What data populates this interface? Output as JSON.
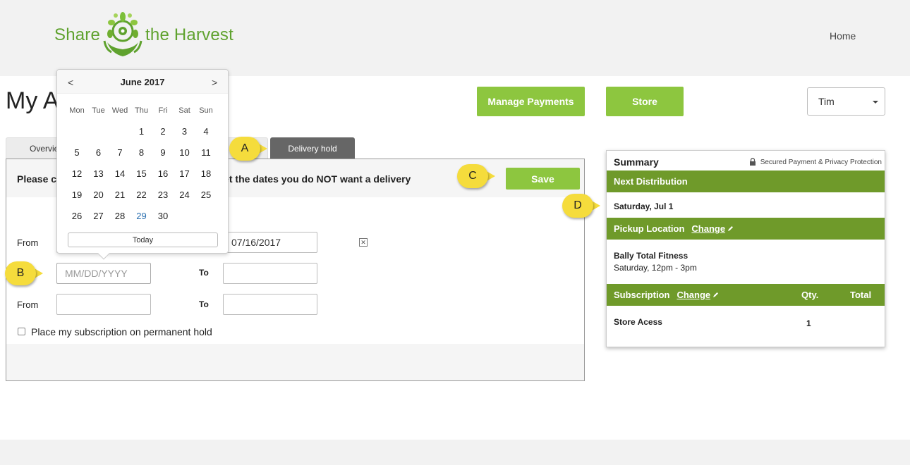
{
  "brand": {
    "left": "Share",
    "right": "the Harvest",
    "color": "#5fa22e"
  },
  "nav": {
    "home": "Home"
  },
  "page": {
    "title": "My Ac"
  },
  "buttons": {
    "manage_payments": "Manage Payments",
    "store": "Store",
    "save": "Save",
    "accent": "#8dc63f"
  },
  "user": {
    "selected": "Tim"
  },
  "tabs": {
    "overview": "Overvie",
    "delivery_hold": "Delivery hold"
  },
  "panel": {
    "instruction_start": "Please c",
    "instruction_end": "et the dates you do NOT want a delivery",
    "rows": [
      {
        "from_label": "From",
        "from_value": "",
        "to_label": "",
        "to_value": "07/16/2017"
      },
      {
        "from_label": "",
        "from_placeholder": "MM/DD/YYYY",
        "to_label": "To",
        "to_value": ""
      },
      {
        "from_label": "From",
        "from_value": "",
        "to_label": "To",
        "to_value": ""
      }
    ],
    "clear_symbol": "✕",
    "permanent_hold": "Place my subscription on permanent hold"
  },
  "calendar": {
    "prev": "<",
    "next": ">",
    "month": "June 2017",
    "weekdays": [
      "Mon",
      "Tue",
      "Wed",
      "Thu",
      "Fri",
      "Sat",
      "Sun"
    ],
    "first_weekday_index": 3,
    "days_in_month": 30,
    "today": 29,
    "today_button": "Today"
  },
  "summary": {
    "title": "Summary",
    "secure": "Secured Payment & Privacy Protection",
    "next_distribution_label": "Next Distribution",
    "next_distribution_value": "Saturday, Jul 1",
    "pickup_label": "Pickup Location",
    "change": "Change",
    "pickup_name": "Bally Total Fitness",
    "pickup_time": "Saturday, 12pm - 3pm",
    "subscription_label": "Subscription",
    "qty_label": "Qty.",
    "total_label": "Total",
    "item_name": "Store Acess",
    "item_qty": "1",
    "bar_color": "#6f9a2a"
  },
  "callouts": {
    "a": "A",
    "b": "B",
    "c": "C",
    "d": "D",
    "color": "#f5dc3c"
  }
}
